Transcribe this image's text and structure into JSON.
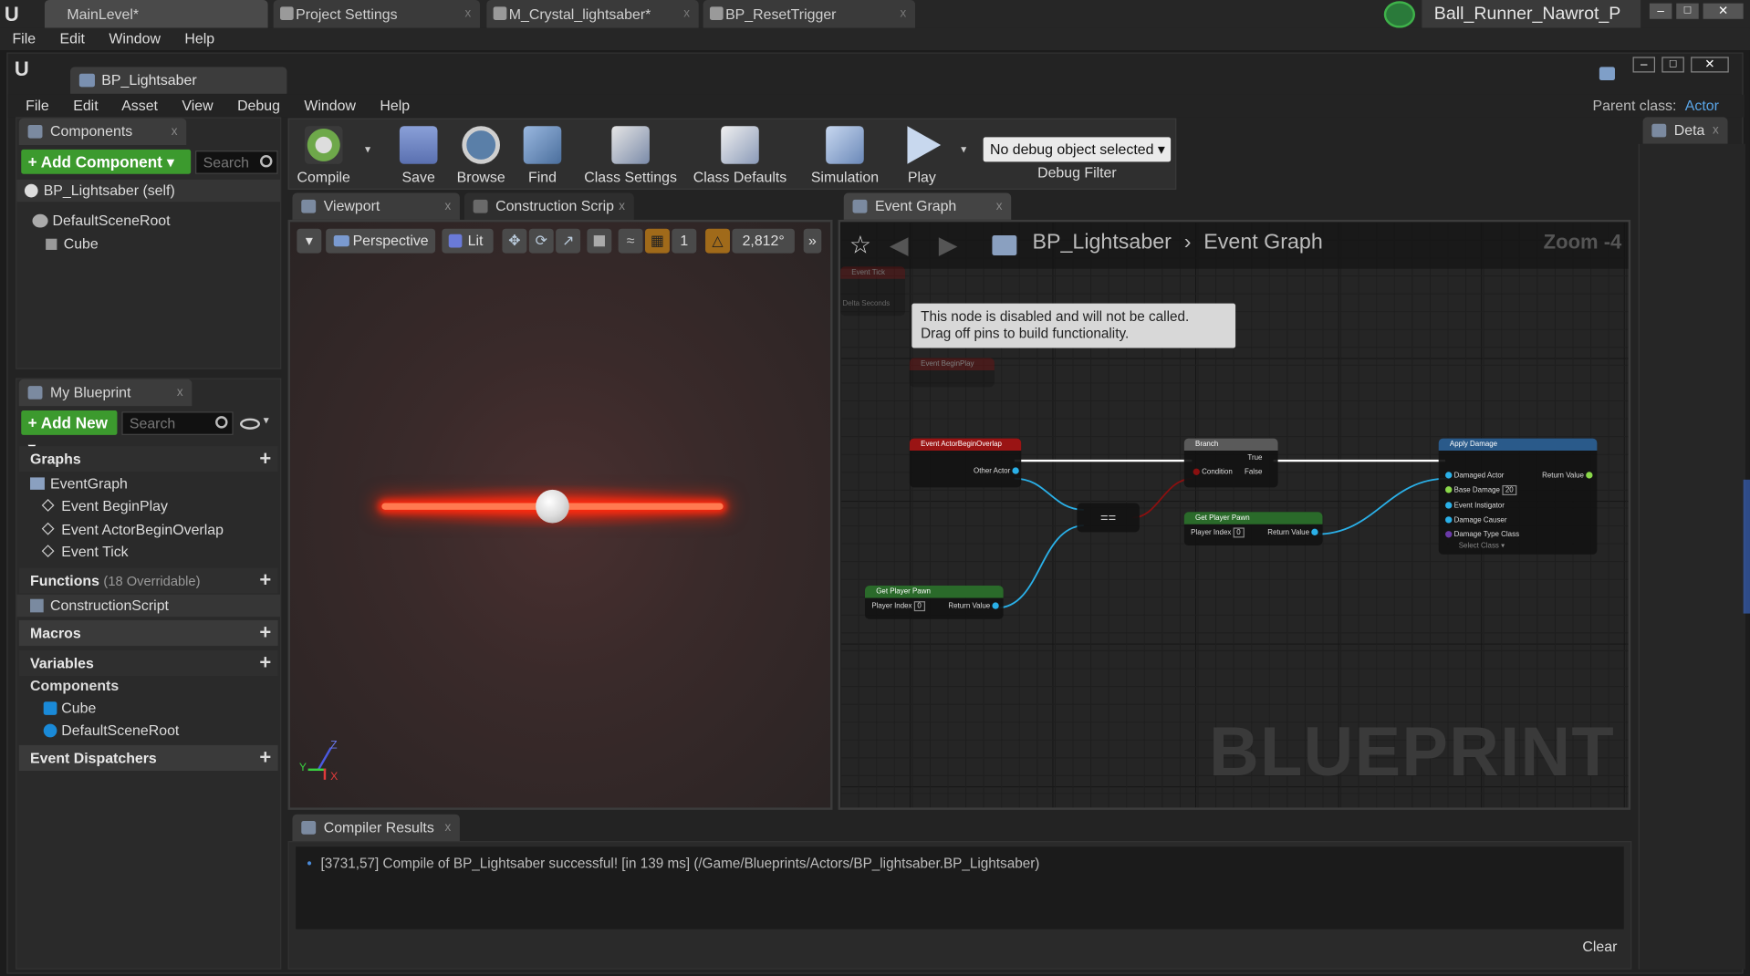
{
  "window_tabs": [
    {
      "label": "MainLevel*"
    },
    {
      "label": "Project Settings"
    },
    {
      "label": "M_Crystal_lightsaber*"
    },
    {
      "label": "BP_ResetTrigger"
    }
  ],
  "project_name": "Ball_Runner_Nawrot_P",
  "main_menu": [
    "File",
    "Edit",
    "Window",
    "Help"
  ],
  "asset_tab": "BP_Lightsaber",
  "editor_menu": [
    "File",
    "Edit",
    "Asset",
    "View",
    "Debug",
    "Window",
    "Help"
  ],
  "parent_class": {
    "label": "Parent class:",
    "value": "Actor"
  },
  "components": {
    "tab": "Components",
    "add_button": "+ Add Component ▾",
    "search_placeholder": "Search",
    "self_item": "BP_Lightsaber (self)",
    "tree": [
      {
        "label": "DefaultSceneRoot"
      },
      {
        "label": "Cube"
      }
    ]
  },
  "my_blueprint": {
    "tab": "My Blueprint",
    "add_button": "+ Add New ▾",
    "search_placeholder": "Search",
    "graphs_header": "Graphs",
    "event_graph": "EventGraph",
    "events": [
      "Event BeginPlay",
      "Event ActorBeginOverlap",
      "Event Tick"
    ],
    "functions_header": "Functions",
    "functions_note": "(18 Overridable)",
    "construction_script": "ConstructionScript",
    "macros_header": "Macros",
    "variables_header": "Variables",
    "components_header": "Components",
    "component_vars": [
      "Cube",
      "DefaultSceneRoot"
    ],
    "dispatchers_header": "Event Dispatchers"
  },
  "toolbar": {
    "buttons": [
      {
        "label": "Compile",
        "icon": "compile-icon"
      },
      {
        "label": "Save",
        "icon": "save-icon"
      },
      {
        "label": "Browse",
        "icon": "browse-icon"
      },
      {
        "label": "Find",
        "icon": "find-icon"
      },
      {
        "label": "Class Settings",
        "icon": "class-settings-icon"
      },
      {
        "label": "Class Defaults",
        "icon": "class-defaults-icon"
      },
      {
        "label": "Simulation",
        "icon": "simulation-icon"
      },
      {
        "label": "Play",
        "icon": "play-icon"
      }
    ],
    "debug_select": "No debug object selected ▾",
    "debug_filter": "Debug Filter"
  },
  "viewport": {
    "tabs": [
      "Viewport",
      "Construction Scrip"
    ],
    "perspective": "Perspective",
    "lit": "Lit",
    "grid_value": "1",
    "angle_value": "2,812°",
    "axis_y": "Y",
    "axis_x": "X",
    "axis_z": "Z"
  },
  "event_graph": {
    "tab": "Event Graph",
    "breadcrumb_root": "BP_Lightsaber",
    "breadcrumb_leaf": "Event Graph",
    "zoom": "Zoom -4",
    "watermark": "BLUEPRINT",
    "tooltip_line1": "This node is disabled and will not be called.",
    "tooltip_line2": "Drag off pins to build functionality.",
    "nodes": {
      "event_tick": {
        "title": "Event Tick",
        "pin": "Delta Seconds"
      },
      "event_beginplay": {
        "title": "Event BeginPlay"
      },
      "overlap": {
        "title": "Event ActorBeginOverlap",
        "pin": "Other Actor"
      },
      "equals": {
        "title": "=="
      },
      "branch": {
        "title": "Branch",
        "condition": "Condition",
        "true": "True",
        "false": "False"
      },
      "get_pawn_1": {
        "title": "Get Player Pawn",
        "index_label": "Player Index",
        "index": "0",
        "ret": "Return Value"
      },
      "get_pawn_2": {
        "title": "Get Player Pawn",
        "index_label": "Player Index",
        "index": "0",
        "ret": "Return Value"
      },
      "apply_damage": {
        "title": "Apply Damage",
        "damaged_actor": "Damaged Actor",
        "base_damage": "Base Damage",
        "base_damage_val": "20",
        "ret": "Return Value",
        "instigator": "Event Instigator",
        "causer": "Damage Causer",
        "damage_type": "Damage Type Class",
        "select": "Select Class ▾"
      }
    }
  },
  "details": {
    "tab": "Deta"
  },
  "compiler": {
    "tab": "Compiler Results",
    "message": "[3731,57] Compile of BP_Lightsaber successful! [in 139 ms] (/Game/Blueprints/Actors/BP_lightsaber.BP_Lightsaber)",
    "clear": "Clear"
  },
  "colors": {
    "accent_green": "#3c9a2e",
    "saber_red": "#ff2a10",
    "exec_white": "#ffffff",
    "object_pin": "#2ab0e8"
  }
}
